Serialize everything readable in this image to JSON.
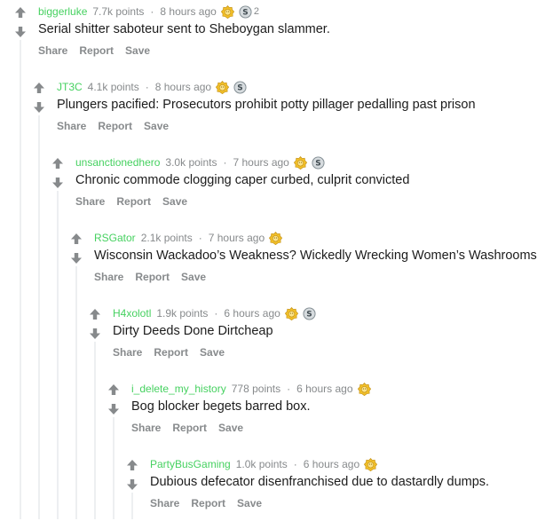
{
  "actions": {
    "share": "Share",
    "report": "Report",
    "save": "Save"
  },
  "comments": [
    {
      "author": "biggerluke",
      "points": "7.7k points",
      "time": "8 hours ago",
      "award_count": "2",
      "body": "Serial shitter saboteur sent to Sheboygan slammer.",
      "awards": [
        "gold-award",
        "silver-award"
      ]
    },
    {
      "author": "JT3C",
      "points": "4.1k points",
      "time": "8 hours ago",
      "award_count": "",
      "body": "Plungers pacified: Prosecutors prohibit potty pillager pedalling past prison",
      "awards": [
        "gold-award",
        "silver-award"
      ]
    },
    {
      "author": "unsanctionedhero",
      "points": "3.0k points",
      "time": "7 hours ago",
      "award_count": "",
      "body": "Chronic commode clogging caper curbed, culprit convicted",
      "awards": [
        "gold-award",
        "silver-award"
      ]
    },
    {
      "author": "RSGator",
      "points": "2.1k points",
      "time": "7 hours ago",
      "award_count": "",
      "body": "Wisconsin Wackadoo’s Weakness? Wickedly Wrecking Women’s Washrooms",
      "awards": [
        "gold-award"
      ]
    },
    {
      "author": "H4xolotl",
      "points": "1.9k points",
      "time": "6 hours ago",
      "award_count": "",
      "body": "Dirty Deeds Done Dirtcheap",
      "awards": [
        "gold-award",
        "silver-award"
      ]
    },
    {
      "author": "i_delete_my_history",
      "points": "778 points",
      "time": "6 hours ago",
      "award_count": "",
      "body": "Bog blocker begets barred box.",
      "awards": [
        "gold-award"
      ]
    },
    {
      "author": "PartyBusGaming",
      "points": "1.0k points",
      "time": "6 hours ago",
      "award_count": "",
      "body": "Dubious defecator disenfranchised due to dastardly dumps.",
      "awards": [
        "gold-award"
      ]
    }
  ],
  "colors": {
    "author": "#46d160",
    "meta": "#878a8c",
    "arrow": "#878a8c",
    "thread_line": "#edeff1",
    "text": "#1c1c1c",
    "gold": "#f2c029",
    "silver": "#aab3b8"
  }
}
